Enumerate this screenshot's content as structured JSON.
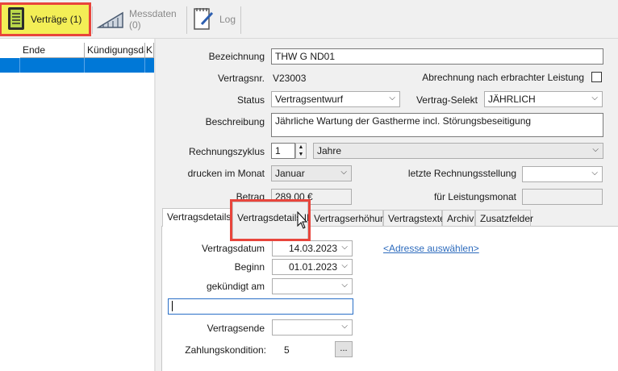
{
  "toolbar": {
    "contracts_label": "Verträge (1)",
    "measurements_label": "Messdaten (0)",
    "log_label": "Log"
  },
  "grid": {
    "columns": [
      "Ende",
      "Kündigungsda",
      "K"
    ]
  },
  "form": {
    "bezeichnung_label": "Bezeichnung",
    "bezeichnung_value": "THW G ND01",
    "vertragsnr_label": "Vertragsnr.",
    "vertragsnr_value": "V23003",
    "abrechnung_label": "Abrechnung nach erbrachter Leistung",
    "status_label": "Status",
    "status_value": "Vertragsentwurf",
    "selekt_label": "Vertrag-Selekt",
    "selekt_value": "JÄHRLICH",
    "beschreibung_label": "Beschreibung",
    "beschreibung_value": "Jährliche Wartung der Gastherme incl. Störungsbeseitigung",
    "zyklus_label": "Rechnungszyklus",
    "zyklus_value": "1",
    "zyklus_unit": "Jahre",
    "drucken_label": "drucken im Monat",
    "drucken_value": "Januar",
    "letzte_label": "letzte Rechnungsstellung",
    "betrag_label": "Betrag",
    "betrag_value": "289,00 €",
    "leistungsmonat_label": "für Leistungsmonat"
  },
  "tabs": [
    {
      "label": "Vertragsdetails I"
    },
    {
      "label": "Vertragsdetails II"
    },
    {
      "label": "Vertragserhöhung"
    },
    {
      "label": "Vertragstexte"
    },
    {
      "label": "Archiv"
    },
    {
      "label": "Zusatzfelder"
    }
  ],
  "details": {
    "vertragsdatum_label": "Vertragsdatum",
    "vertragsdatum_value": "14.03.2023",
    "beginn_label": "Beginn",
    "beginn_value": "01.01.2023",
    "gekuendigt_label": "gekündigt am",
    "address_link": "<Adresse auswählen>",
    "vertragsende_label": "Vertragsende",
    "zahlung_label": "Zahlungskondition:",
    "zahlung_value": "5",
    "dots_label": "..."
  },
  "colors": {
    "highlight": "#f3ee56",
    "highlight_border": "#e8453c",
    "selection": "#0078d7",
    "link": "#2d6bbd"
  }
}
